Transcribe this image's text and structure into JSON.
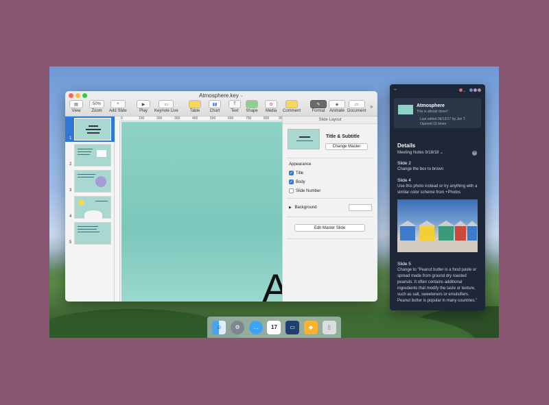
{
  "window": {
    "title": "Atmosphere.key"
  },
  "toolbar": {
    "view": "View",
    "zoom": "Zoom",
    "zoom_value": "50%",
    "add_slide": "Add Slide",
    "play": "Play",
    "keynote_live": "Keynote Live",
    "table": "Table",
    "chart": "Chart",
    "text": "Text",
    "shape": "Shape",
    "media": "Media",
    "comment": "Comment",
    "format": "Format",
    "animate": "Animate",
    "document": "Document",
    "more": "»"
  },
  "navigator": {
    "slides": [
      "1",
      "2",
      "3",
      "4",
      "5"
    ],
    "selected": "1"
  },
  "ruler": {
    "ticks": [
      "0",
      "100",
      "200",
      "300",
      "400",
      "500",
      "600",
      "700",
      "800",
      "900"
    ]
  },
  "canvas": {
    "visible_text": "AT"
  },
  "inspector": {
    "header": "Slide Layout",
    "master_name": "Title & Subtitle",
    "change_master": "Change Master",
    "appearance": "Appearance",
    "title_check": "Title",
    "body_check": "Body",
    "slide_number_check": "Slide Number",
    "background": "Background",
    "edit_master": "Edit Master Slide",
    "title_on": true,
    "body_on": true,
    "slide_number_on": false
  },
  "panel": {
    "card_title": "Atmosphere",
    "card_subtitle": "This is almost done!!",
    "card_meta1": "Last edited 06/12/17 by Jen T.",
    "card_meta2": "Opened 15 times",
    "details": "Details",
    "notes_selector": "Meeting Notes 9/18/18",
    "add": "+",
    "items": [
      {
        "title": "Slide 2",
        "text": "Change the box to brown"
      },
      {
        "title": "Slide 4",
        "text": "Use this photo instead or try anything with a similar color scheme from +Photos"
      },
      {
        "title": "Slide 5",
        "text": "Change to \"Peanut butter is a food paste or spread made from ground dry roasted peanuts. It often contains additional ingredients that modify the taste or texture, such as salt, sweeteners or emulsifiers. Peanut butter is popular in many countries.\""
      }
    ]
  },
  "dock": {
    "items": [
      "finder-icon",
      "system-preferences-icon",
      "messages-icon",
      "calendar-icon",
      "files-icon",
      "sketch-icon",
      "trash-icon"
    ],
    "calendar_day": "17"
  },
  "colors": {
    "background": "#8a5773",
    "panel": "#1d2737",
    "accent": "#2f78d8",
    "slide": "#8fd2c6"
  }
}
